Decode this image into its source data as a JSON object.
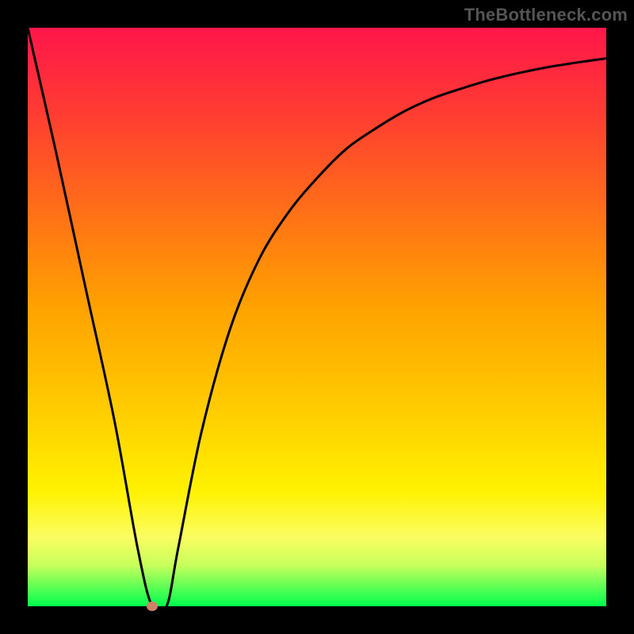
{
  "watermark": "TheBottleneck.com",
  "chart_data": {
    "type": "line",
    "title": "",
    "xlabel": "",
    "ylabel": "",
    "xlim": [
      0,
      100
    ],
    "ylim": [
      0,
      100
    ],
    "grid": false,
    "series": [
      {
        "name": "bottleneck-curve",
        "x": [
          0,
          5,
          10,
          15,
          19,
          21.5,
          24,
          26,
          30,
          35,
          40,
          45,
          50,
          55,
          60,
          65,
          70,
          75,
          80,
          85,
          90,
          95,
          100
        ],
        "values": [
          100,
          78,
          55,
          32,
          10,
          0,
          0,
          10,
          30,
          48,
          60,
          68,
          74,
          79,
          82.5,
          85.5,
          87.8,
          89.5,
          91,
          92.2,
          93.2,
          94,
          94.7
        ]
      }
    ],
    "marker": {
      "x": 21.5,
      "y": 0,
      "color": "#d08068",
      "rx": 7,
      "ry": 6
    },
    "colors": {
      "curve": "#000000",
      "background_top": "#ff164a",
      "background_bottom": "#00ff4e",
      "frame": "#000000"
    }
  }
}
